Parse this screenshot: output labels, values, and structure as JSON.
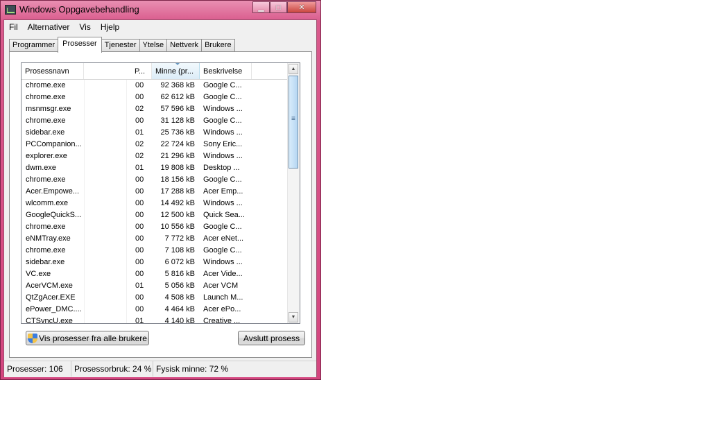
{
  "window": {
    "title": "Windows Oppgavebehandling"
  },
  "menu": [
    "Fil",
    "Alternativer",
    "Vis",
    "Hjelp"
  ],
  "tabs": [
    "Programmer",
    "Prosesser",
    "Tjenester",
    "Ytelse",
    "Nettverk",
    "Brukere"
  ],
  "active_tab": "Prosesser",
  "columns": {
    "name": "Prosessnavn",
    "p": "P...",
    "mem": "Minne (pr...",
    "desc": "Beskrivelse"
  },
  "processes": [
    {
      "name": "chrome.exe",
      "p": "00",
      "mem": "92 368 kB",
      "desc": "Google C..."
    },
    {
      "name": "chrome.exe",
      "p": "00",
      "mem": "62 612 kB",
      "desc": "Google C..."
    },
    {
      "name": "msnmsgr.exe",
      "p": "02",
      "mem": "57 596 kB",
      "desc": "Windows ..."
    },
    {
      "name": "chrome.exe",
      "p": "00",
      "mem": "31 128 kB",
      "desc": "Google C..."
    },
    {
      "name": "sidebar.exe",
      "p": "01",
      "mem": "25 736 kB",
      "desc": "Windows ..."
    },
    {
      "name": "PCCompanion...",
      "p": "02",
      "mem": "22 724 kB",
      "desc": "Sony Eric..."
    },
    {
      "name": "explorer.exe",
      "p": "02",
      "mem": "21 296 kB",
      "desc": "Windows ..."
    },
    {
      "name": "dwm.exe",
      "p": "01",
      "mem": "19 808 kB",
      "desc": "Desktop ..."
    },
    {
      "name": "chrome.exe",
      "p": "00",
      "mem": "18 156 kB",
      "desc": "Google C..."
    },
    {
      "name": "Acer.Empowe...",
      "p": "00",
      "mem": "17 288 kB",
      "desc": "Acer Emp..."
    },
    {
      "name": "wlcomm.exe",
      "p": "00",
      "mem": "14 492 kB",
      "desc": "Windows ..."
    },
    {
      "name": "GoogleQuickS...",
      "p": "00",
      "mem": "12 500 kB",
      "desc": "Quick Sea..."
    },
    {
      "name": "chrome.exe",
      "p": "00",
      "mem": "10 556 kB",
      "desc": "Google C..."
    },
    {
      "name": "eNMTray.exe",
      "p": "00",
      "mem": "7 772 kB",
      "desc": "Acer eNet..."
    },
    {
      "name": "chrome.exe",
      "p": "00",
      "mem": "7 108 kB",
      "desc": "Google C..."
    },
    {
      "name": "sidebar.exe",
      "p": "00",
      "mem": "6 072 kB",
      "desc": "Windows ..."
    },
    {
      "name": "VC.exe",
      "p": "00",
      "mem": "5 816 kB",
      "desc": "Acer Vide..."
    },
    {
      "name": "AcerVCM.exe",
      "p": "01",
      "mem": "5 056 kB",
      "desc": "Acer VCM"
    },
    {
      "name": "QtZgAcer.EXE",
      "p": "00",
      "mem": "4 508 kB",
      "desc": "Launch M..."
    },
    {
      "name": "ePower_DMC....",
      "p": "00",
      "mem": "4 464 kB",
      "desc": "Acer ePo..."
    },
    {
      "name": "CTSyncU.exe",
      "p": "01",
      "mem": "4 140 kB",
      "desc": "Creative ..."
    }
  ],
  "buttons": {
    "show_all": "Vis prosesser fra alle brukere",
    "end": "Avslutt prosess"
  },
  "status": {
    "processes": "Prosesser: 106",
    "cpu": "Prosessorbruk: 24 %",
    "memory": "Fysisk minne: 72 %"
  }
}
